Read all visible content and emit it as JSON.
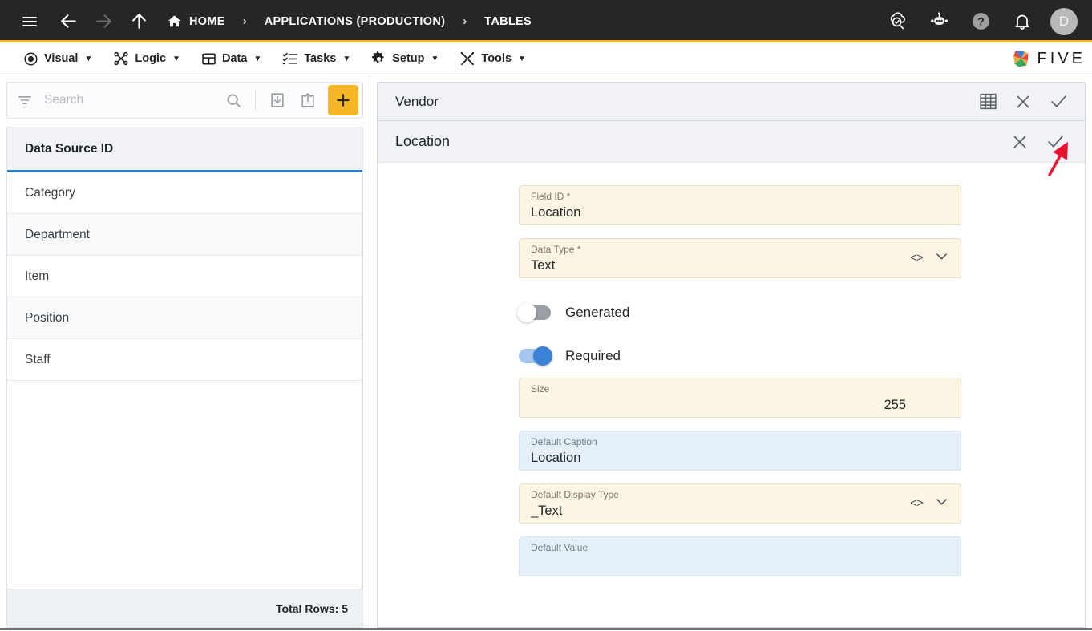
{
  "topbar": {
    "menu_icon": "hamburger-icon",
    "back_icon": "arrow-left-icon",
    "forward_icon": "arrow-right-icon",
    "up_icon": "arrow-up-icon",
    "breadcrumbs": [
      {
        "label": "HOME",
        "icon": "home-icon"
      },
      {
        "label": "APPLICATIONS (PRODUCTION)",
        "icon": ""
      },
      {
        "label": "TABLES",
        "icon": ""
      }
    ],
    "separator": "›",
    "actions": [
      {
        "name": "cloud-search-icon"
      },
      {
        "name": "chatbot-icon"
      },
      {
        "name": "help-icon"
      },
      {
        "name": "notifications-bell-icon"
      }
    ],
    "avatar_initial": "D"
  },
  "menubar": {
    "items": [
      {
        "label": "Visual",
        "icon": "eye-icon"
      },
      {
        "label": "Logic",
        "icon": "nodes-icon"
      },
      {
        "label": "Data",
        "icon": "table-icon"
      },
      {
        "label": "Tasks",
        "icon": "checklist-icon"
      },
      {
        "label": "Setup",
        "icon": "gear-icon"
      },
      {
        "label": "Tools",
        "icon": "tools-icon"
      }
    ],
    "caret": "▼",
    "brand": "FIVE"
  },
  "sidebar": {
    "search": {
      "placeholder": "Search",
      "value": "",
      "filter_icon": "filter-icon",
      "search_icon": "search-icon"
    },
    "toolbar": {
      "import_icon": "import-icon",
      "export_icon": "export-icon",
      "add_icon": "plus-icon"
    },
    "list": {
      "column_header": "Data Source ID",
      "rows": [
        {
          "label": "Category"
        },
        {
          "label": "Department"
        },
        {
          "label": "Item"
        },
        {
          "label": "Position"
        },
        {
          "label": "Staff"
        }
      ]
    },
    "footer": {
      "total_rows_label": "Total Rows: 5"
    }
  },
  "main": {
    "panel": {
      "title": "Vendor",
      "actions": [
        {
          "name": "grid-view-icon"
        },
        {
          "name": "close-icon"
        },
        {
          "name": "confirm-check-icon"
        }
      ]
    },
    "sub_panel": {
      "title": "Location",
      "actions": [
        {
          "name": "close-icon"
        },
        {
          "name": "confirm-check-icon"
        }
      ]
    },
    "form": {
      "fields": [
        {
          "label": "Field ID *",
          "value": "Location",
          "style": "cream",
          "has_code_icon": false,
          "has_dropdown": false,
          "align": "left",
          "name": "field-id-input"
        },
        {
          "label": "Data Type *",
          "value": "Text",
          "style": "cream",
          "has_code_icon": true,
          "has_dropdown": true,
          "align": "left",
          "name": "data-type-select"
        },
        {
          "label": "Size",
          "value": "255",
          "style": "cream",
          "has_code_icon": false,
          "has_dropdown": false,
          "align": "right",
          "name": "size-input"
        },
        {
          "label": "Default Caption",
          "value": "Location",
          "style": "blue",
          "has_code_icon": false,
          "has_dropdown": false,
          "align": "left",
          "name": "default-caption-input"
        },
        {
          "label": "Default Display Type",
          "value": "_Text",
          "style": "cream",
          "has_code_icon": true,
          "has_dropdown": true,
          "align": "left",
          "name": "default-display-type-select"
        },
        {
          "label": "Default Value",
          "value": "",
          "style": "blue",
          "has_code_icon": false,
          "has_dropdown": false,
          "align": "left",
          "name": "default-value-input"
        }
      ],
      "toggles": [
        {
          "label": "Generated",
          "state": "off",
          "name": "generated-toggle"
        },
        {
          "label": "Required",
          "state": "on",
          "name": "required-toggle"
        }
      ]
    }
  },
  "annotation": {
    "type": "arrow",
    "color": "#E8112D",
    "points_to": "sub-panel-confirm-check-icon"
  },
  "colors": {
    "topbar_bg": "#262626",
    "accent_yellow": "#F5B324",
    "cream_field": "#FDF5E4",
    "blue_field": "#E5EFF9",
    "header_gray": "#F0F2F5",
    "toggle_on": "#3B82D6",
    "selection_underline": "#2F7FD1",
    "annotation_red": "#E8112D"
  }
}
